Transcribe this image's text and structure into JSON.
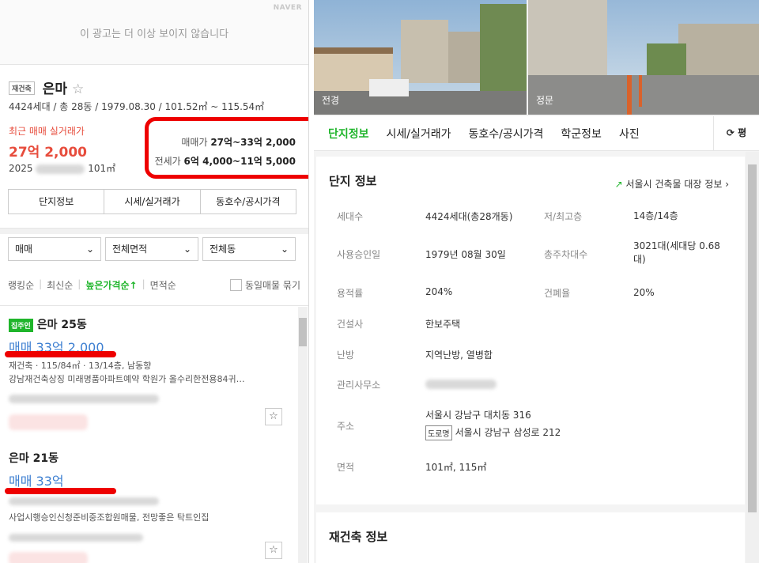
{
  "ad": {
    "brand": "NAVER",
    "message": "이 광고는 더 이상 보이지 않습니다"
  },
  "complex": {
    "tag": "재건축",
    "name": "은마",
    "meta": "4424세대 / 총 28동 / 1979.08.30 / 101.52㎡ ~ 115.54㎡",
    "recent_label": "최근 매매 실거래가",
    "recent_price": "27억 2,000",
    "recent_date_prefix": "2025",
    "recent_area": "101㎡"
  },
  "price_box": {
    "sale_label": "매매가",
    "sale_value": "27억~33억 2,000",
    "jeonse_label": "전세가",
    "jeonse_value": "6억 4,000~11억 5,000"
  },
  "left_tabs": [
    "단지정보",
    "시세/실거래가",
    "동호수/공시가격"
  ],
  "filters": [
    "매매",
    "전체면적",
    "전체동"
  ],
  "sort": {
    "rank": "랭킹순",
    "latest": "최신순",
    "high": "높은가격순↑",
    "area": "면적순",
    "group": "동일매물 묶기"
  },
  "listings": [
    {
      "owner": "집주인",
      "title": "은마 25동",
      "price": "매매 33억 2,000",
      "spec": "재건축 · 115/84㎡ · 13/14층, 남동향",
      "desc": "강남재건축상징 미래명품아파트예약 학원가 올수리한전용84귀…"
    },
    {
      "title": "은마 21동",
      "price": "매매 33억",
      "desc": "사업시행승인신청준비중조합원매물, 전망좋은 탁트인집"
    }
  ],
  "photos": {
    "front": "전경",
    "gate": "정문"
  },
  "right_tabs": [
    "단지정보",
    "시세/실거래가",
    "동호수/공시가격",
    "학군정보",
    "사진"
  ],
  "pyeong": "평",
  "info": {
    "heading": "단지 정보",
    "ext_link": "서울시 건축물 대장 정보",
    "households_k": "세대수",
    "households_v": "4424세대(총28개동)",
    "floors_k": "저/최고층",
    "floors_v": "14층/14층",
    "approval_k": "사용승인일",
    "approval_v": "1979년 08월 30일",
    "parking_k": "총주차대수",
    "parking_v": "3021대(세대당 0.68대)",
    "far_k": "용적률",
    "far_v": "204%",
    "bcr_k": "건폐율",
    "bcr_v": "20%",
    "builder_k": "건설사",
    "builder_v": "한보주택",
    "heating_k": "난방",
    "heating_v": "지역난방, 열병합",
    "office_k": "관리사무소",
    "addr_k": "주소",
    "addr_v": "서울시 강남구 대치동 316",
    "road_tag": "도로명",
    "road_v": "서울시 강남구 삼성로 212",
    "area_k": "면적",
    "area_v": "101㎡, 115㎡"
  },
  "rebuild_heading": "재건축 정보"
}
